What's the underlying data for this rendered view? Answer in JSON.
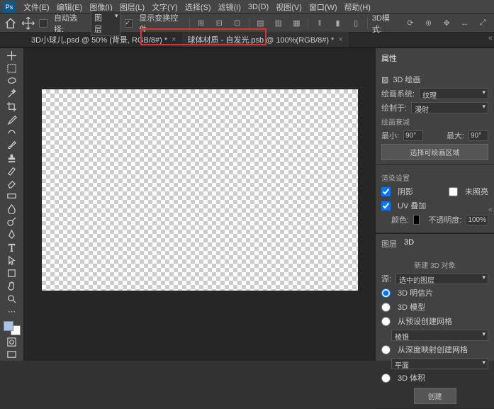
{
  "menu": {
    "items": [
      "文件(E)",
      "编辑(E)",
      "图像(I)",
      "图层(L)",
      "文字(Y)",
      "选择(S)",
      "滤镜(I)",
      "3D(D)",
      "视图(V)",
      "窗口(W)",
      "帮助(H)"
    ]
  },
  "options": {
    "auto_select_label": "自动选择:",
    "layer_label": "图层",
    "show_transform_label": "显示变换控件",
    "mode_label": "3D模式:"
  },
  "tabs": [
    {
      "label": "3D小球儿.psd @ 50% (背景, RGB/8#) *"
    },
    {
      "label": "球体材质 - 自发光.psb @ 100%(RGB/8#) *"
    }
  ],
  "props": {
    "title": "属性",
    "paint_label": "3D 绘画",
    "paint_system_label": "绘画系统:",
    "paint_system_value": "纹理",
    "paint_to_label": "绘制于:",
    "paint_to_value": "漫射",
    "fade_label": "绘画衰减",
    "min_label": "最小:",
    "min_value": "90°",
    "max_label": "最大:",
    "max_value": "90°",
    "select_area_btn": "选择可绘画区域",
    "render_label": "渲染设置",
    "shadow_label": "阴影",
    "unlit_label": "未照亮",
    "uv_overlay_label": "UV 叠加",
    "color_label": "颜色:",
    "opacity_label": "不透明度:",
    "opacity_value": "100%"
  },
  "panel3d": {
    "tab_layers": "图层",
    "tab_3d": "3D",
    "new_obj_label": "新建 3D 对象",
    "source_label": "源:",
    "source_value": "选中的图层",
    "opt_postcard": "3D 明信片",
    "opt_model": "3D 模型",
    "opt_preset": "从预设创建网格",
    "preset_value": "棱锥",
    "opt_depth": "从深度映射创建网格",
    "depth_value": "平面",
    "opt_volume": "3D 体积",
    "create_btn": "创建"
  }
}
